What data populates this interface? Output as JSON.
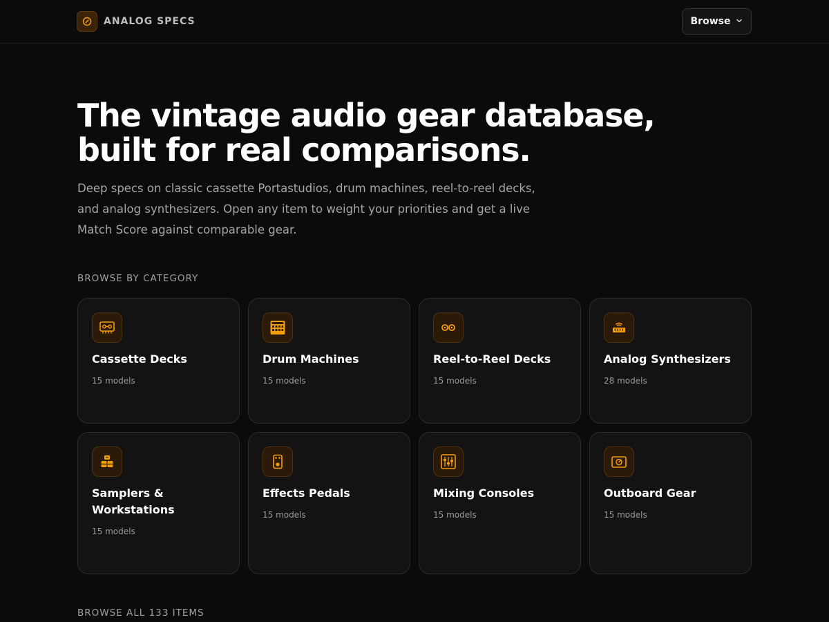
{
  "header": {
    "brand": "ANALOG SPECS",
    "browse_label": "Browse"
  },
  "hero": {
    "title_line1": "The vintage audio gear database,",
    "title_line2": "built for real comparisons.",
    "description": "Deep specs on classic cassette Portastudios, drum machines, reel-to-reel decks, and analog synthesizers. Open any item to weight your priorities and get a live Match Score against comparable gear."
  },
  "categories_section": {
    "label": "BROWSE BY CATEGORY",
    "items": [
      {
        "name": "Cassette Decks",
        "count": "15 models",
        "icon": "cassette-icon"
      },
      {
        "name": "Drum Machines",
        "count": "15 models",
        "icon": "drum-machine-icon"
      },
      {
        "name": "Reel-to-Reel Decks",
        "count": "15 models",
        "icon": "reel-to-reel-icon"
      },
      {
        "name": "Analog Synthesizers",
        "count": "28 models",
        "icon": "synthesizer-icon"
      },
      {
        "name": "Samplers & Workstations",
        "count": "15 models",
        "icon": "sampler-icon"
      },
      {
        "name": "Effects Pedals",
        "count": "15 models",
        "icon": "effects-pedal-icon"
      },
      {
        "name": "Mixing Consoles",
        "count": "15 models",
        "icon": "mixing-console-icon"
      },
      {
        "name": "Outboard Gear",
        "count": "15 models",
        "icon": "outboard-gear-icon"
      }
    ]
  },
  "all_items_section": {
    "label": "BROWSE ALL 133 ITEMS"
  },
  "colors": {
    "accent": "#f59e0b",
    "background": "#0b0b0b",
    "card": "#131313"
  }
}
